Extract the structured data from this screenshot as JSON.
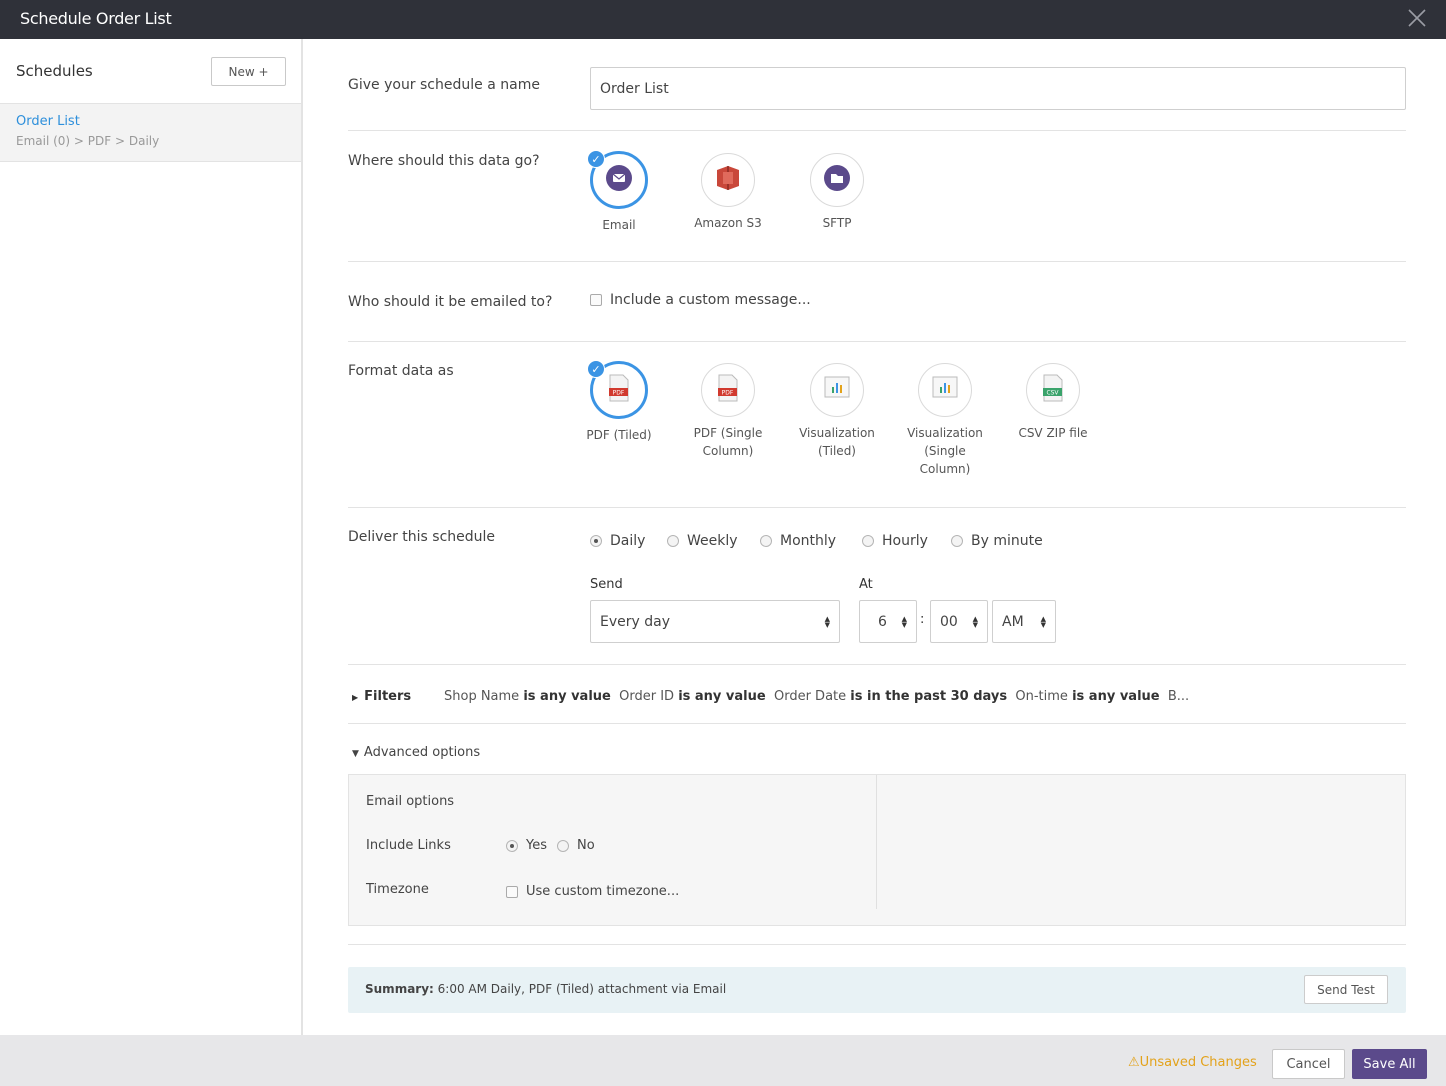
{
  "window": {
    "title": "Schedule Order List"
  },
  "sidebar": {
    "title": "Schedules",
    "new_button": "New +",
    "items": [
      {
        "name": "Order List",
        "crumbs": "Email (0)  >  PDF  >  Daily"
      }
    ]
  },
  "form": {
    "name_label": "Give your schedule a name",
    "name_value": "Order List",
    "destination_label": "Where should this data go?",
    "destinations": [
      {
        "label": "Email",
        "icon": "email-icon",
        "selected": true
      },
      {
        "label": "Amazon S3",
        "icon": "amazon-s3-icon",
        "selected": false
      },
      {
        "label": "SFTP",
        "icon": "sftp-icon",
        "selected": false
      }
    ],
    "recipients_label": "Who should it be emailed to?",
    "custom_message_label": "Include a custom message...",
    "format_label": "Format data as",
    "formats": [
      {
        "label_line1": "PDF (Tiled)",
        "label_line2": "",
        "label_line3": "",
        "icon": "pdf-icon",
        "selected": true
      },
      {
        "label_line1": "PDF (Single",
        "label_line2": "Column)",
        "label_line3": "",
        "icon": "pdf-icon",
        "selected": false
      },
      {
        "label_line1": "Visualization",
        "label_line2": "(Tiled)",
        "label_line3": "",
        "icon": "visualization-icon",
        "selected": false
      },
      {
        "label_line1": "Visualization",
        "label_line2": "(Single",
        "label_line3": "Column)",
        "icon": "visualization-icon",
        "selected": false
      },
      {
        "label_line1": "CSV ZIP file",
        "label_line2": "",
        "label_line3": "",
        "icon": "csv-icon",
        "selected": false
      }
    ],
    "deliver_label": "Deliver this schedule",
    "frequencies": [
      {
        "label": "Daily",
        "selected": true
      },
      {
        "label": "Weekly",
        "selected": false
      },
      {
        "label": "Monthly",
        "selected": false
      },
      {
        "label": "Hourly",
        "selected": false
      },
      {
        "label": "By minute",
        "selected": false
      }
    ],
    "send_label": "Send",
    "send_value": "Every day",
    "at_label": "At",
    "hour_value": "6",
    "minute_value": "00",
    "ampm_value": "AM",
    "time_separator": ":"
  },
  "filters": {
    "toggle_label": "Filters",
    "items": [
      {
        "field": "Shop Name",
        "condition": "is any value"
      },
      {
        "field": "Order ID",
        "condition": "is any value"
      },
      {
        "field": "Order Date",
        "condition": "is in the past 30 days"
      },
      {
        "field": "On-time",
        "condition": "is any value"
      }
    ],
    "overflow": "B..."
  },
  "advanced": {
    "toggle_label": "Advanced options",
    "section_title": "Email options",
    "include_links_label": "Include Links",
    "yes_label": "Yes",
    "no_label": "No",
    "include_links_value": "Yes",
    "timezone_label": "Timezone",
    "custom_timezone_label": "Use custom timezone..."
  },
  "summary": {
    "prefix": "Summary:",
    "text": " 6:00 AM Daily, PDF (Tiled) attachment via Email",
    "send_test": "Send Test"
  },
  "footer": {
    "unsaved": "Unsaved Changes",
    "cancel": "Cancel",
    "save_all": "Save All"
  },
  "colors": {
    "accent": "#3b94e4",
    "titlebar": "#2f3139",
    "primary_button": "#5b4a8b",
    "warning": "#e3a21a",
    "summary_bg": "#e8f2f5"
  }
}
